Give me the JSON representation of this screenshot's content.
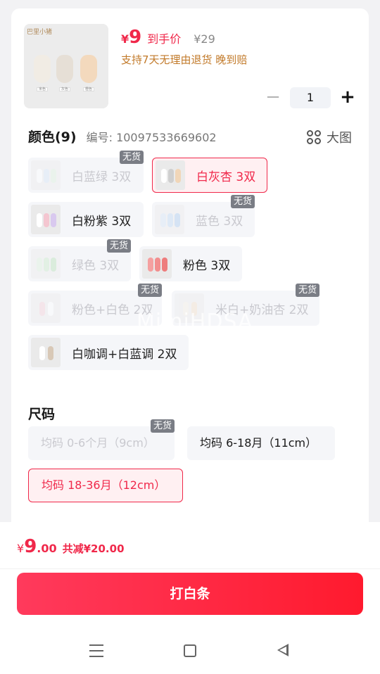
{
  "product": {
    "thumb_logo": "巴里小猪",
    "thumb_tags": [
      "米色",
      "灰色",
      "橙色"
    ],
    "currency": "¥",
    "price": "9",
    "price_label": "到手价",
    "original_price": "¥29",
    "promise": "支持7天无理由退货  晚到赔"
  },
  "quantity": {
    "minus": "−",
    "value": "1",
    "plus": "+"
  },
  "color_section": {
    "title": "颜色(9)",
    "sku": "编号: 10097533669602",
    "big_view": "大图",
    "out_of_stock": "无货",
    "options": [
      {
        "label": "白蓝绿 3双",
        "state": "disabled"
      },
      {
        "label": "白灰杏 3双",
        "state": "selected"
      },
      {
        "label": "白粉紫 3双",
        "state": "normal"
      },
      {
        "label": "蓝色 3双",
        "state": "disabled"
      },
      {
        "label": "绿色 3双",
        "state": "disabled"
      },
      {
        "label": "粉色 3双",
        "state": "normal"
      },
      {
        "label": "粉色+白色 2双",
        "state": "disabled"
      },
      {
        "label": "米白+奶油杏 2双",
        "state": "disabled"
      },
      {
        "label": "白咖调+白蓝调 2双",
        "state": "normal"
      }
    ]
  },
  "size_section": {
    "title": "尺码",
    "options": [
      {
        "label": "均码 0-6个月（9cm）",
        "state": "disabled"
      },
      {
        "label": "均码 6-18月（11cm）",
        "state": "normal"
      },
      {
        "label": "均码 18-36月（12cm）",
        "state": "selected"
      }
    ]
  },
  "watermark": "MimiHDSA",
  "footer": {
    "currency": "¥",
    "total_int": "9",
    "total_dec": ".00",
    "savings": "共减¥20.00",
    "pay_button": "打白条"
  },
  "colors": {
    "accent": "#f0284a",
    "promise": "#c27a2a",
    "badge": "#7a7d85"
  }
}
